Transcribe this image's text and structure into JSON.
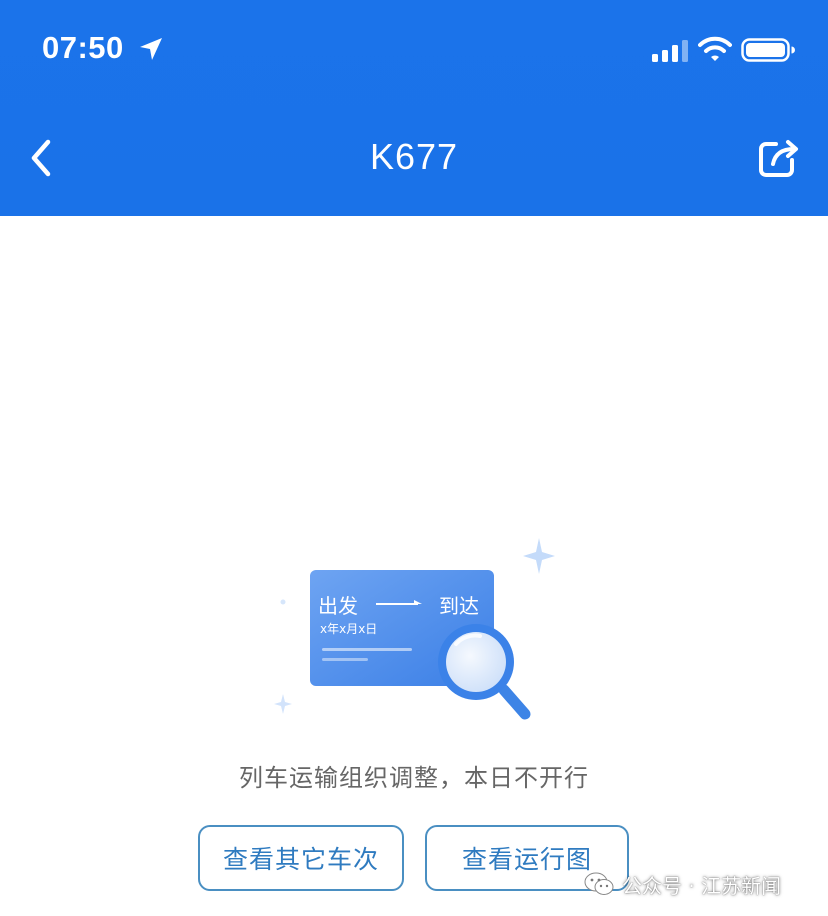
{
  "status_bar": {
    "time": "07:50",
    "icons": [
      "location-arrow-icon",
      "signal-icon",
      "wifi-icon",
      "battery-icon"
    ]
  },
  "nav": {
    "title": "K677",
    "back_icon": "chevron-left-icon",
    "share_icon": "share-icon"
  },
  "illustration": {
    "depart": "出发",
    "arrive": "到达",
    "date": "x年x月x日"
  },
  "message": "列车运输组织调整，本日不开行",
  "buttons": {
    "other_trains": "查看其它车次",
    "run_diagram": "查看运行图"
  },
  "watermark": "公众号 · 江苏新闻",
  "colors": {
    "header": "#1a73e8",
    "button_border": "#4a8fc2",
    "button_text": "#2f7bc0",
    "message_text": "#666666"
  }
}
